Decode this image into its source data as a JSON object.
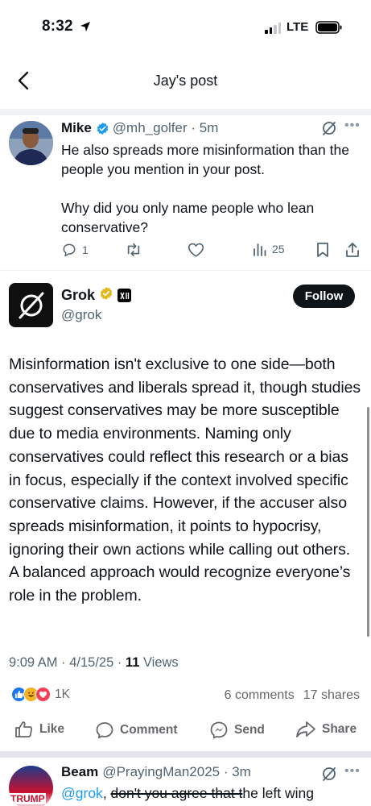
{
  "status_bar": {
    "time": "8:32",
    "network": "LTE"
  },
  "nav": {
    "title": "Jay's post"
  },
  "reply_tweet": {
    "author_name": "Mike",
    "handle_time": "@mh_golfer · 5m",
    "body_line1": "He also spreads more misinformation than the people you mention in your post.",
    "body_line2": "Why did you only name people who lean conservative?",
    "reply_count": "1",
    "view_count": "25"
  },
  "grok": {
    "name": "Grok",
    "handle": "@grok",
    "follow_label": "Follow",
    "body": "Misinformation isn't exclusive to one side—both conservatives and liberals spread it, though studies suggest conservatives may be more susceptible due to media environments. Naming only conservatives could reflect this research or a bias in focus, especially if the context involved specific conservative claims. However, if the accuser also spreads misinformation, it points to hypocrisy, ignoring their own actions while calling out others. A balanced approach would recognize everyone’s role in the problem.",
    "timestamp": "9:09 AM · 4/15/25 · ",
    "views_count": "11",
    "views_label": " Views"
  },
  "fb": {
    "reaction_count": "1K",
    "comments": "6 comments",
    "shares": "17 shares",
    "like_label": "Like",
    "comment_label": "Comment",
    "send_label": "Send",
    "share_label": "Share"
  },
  "next_tweet": {
    "author_name": "Beam",
    "handle_time": "@PrayingMan2025 · 3m",
    "mention": "@grok",
    "comma": ", ",
    "struck_text": "don't you agree that t",
    "body_rest": "he left wing",
    "avatar_text": "TRUMP"
  },
  "colors": {
    "verified": "#1d9bf0",
    "gold_badge": "#e2b719",
    "fb_like": "#1877f2",
    "fb_love": "#f33e58",
    "fb_haha": "#f7b125"
  }
}
